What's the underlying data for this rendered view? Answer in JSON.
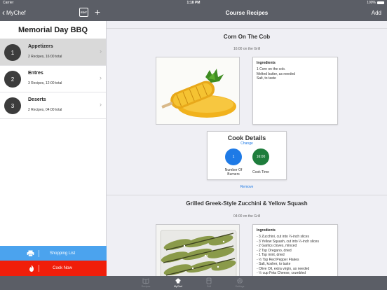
{
  "status": {
    "carrier": "Carrier",
    "time": "1:18 PM",
    "battery": "100%"
  },
  "nav": {
    "back_label": "MyChef",
    "edit_label": "EDIT",
    "title": "Course Recipes",
    "add_label": "Add"
  },
  "sidebar": {
    "plan_title": "Memorial Day BBQ",
    "courses": [
      {
        "number": "1",
        "name": "Appetizers",
        "meta": "2 Recipes,  16:00 total"
      },
      {
        "number": "2",
        "name": "Entres",
        "meta": "3 Recipes,  12:00 total"
      },
      {
        "number": "3",
        "name": "Deserts",
        "meta": "2 Recipes,  04:00 total"
      }
    ],
    "shopping_label": "Shopping List",
    "cook_label": "Cook Now"
  },
  "recipes": [
    {
      "title": "Corn On The Cob",
      "sub": "16:00 on the Grill",
      "ingredients_head": "Ingredients",
      "ingredients": [
        "1 Corn on the cob.",
        "Melted butter, as needed",
        "Salt, to taste"
      ],
      "cook_details": {
        "title": "Cook Details",
        "change": "Change",
        "burners_value": "1",
        "burners_label": "Number Of Burners",
        "time_value": "16:00",
        "time_label": "Cook Time"
      },
      "remove": "Remove"
    },
    {
      "title": "Grilled Greek-Style Zucchini & Yellow Squash",
      "sub": "04:00 on the Grill",
      "ingredients_head": "Ingredients",
      "ingredients": [
        "- 3 Zucchini, cut into ¼-inch slices",
        "- 3 Yellow Squash, cut into ¼-inch slices",
        "- 2 Garlics cloves, minced",
        "- 2 Tsp Oregano, dried",
        "- 1 Tsp mint, dried",
        "- ½ Tsp Red Pepper Flakes",
        "- Salt, kosher, to taste",
        "- Olive Oil, extra virgin, as needed",
        "- ½ cup Feta Cheese, crumbled"
      ]
    }
  ],
  "tabs": [
    {
      "label": "Recipes",
      "icon": "book-icon"
    },
    {
      "label": "MyChef",
      "icon": "chef-hat-icon"
    },
    {
      "label": "Grill",
      "icon": "grill-icon"
    },
    {
      "label": "Settings",
      "icon": "gear-icon"
    }
  ],
  "colors": {
    "bar": "#5b5e66",
    "blue": "#1e7ae6",
    "green": "#1e7d3c",
    "shopping": "#4ba3ee",
    "cook": "#f01e0a"
  }
}
